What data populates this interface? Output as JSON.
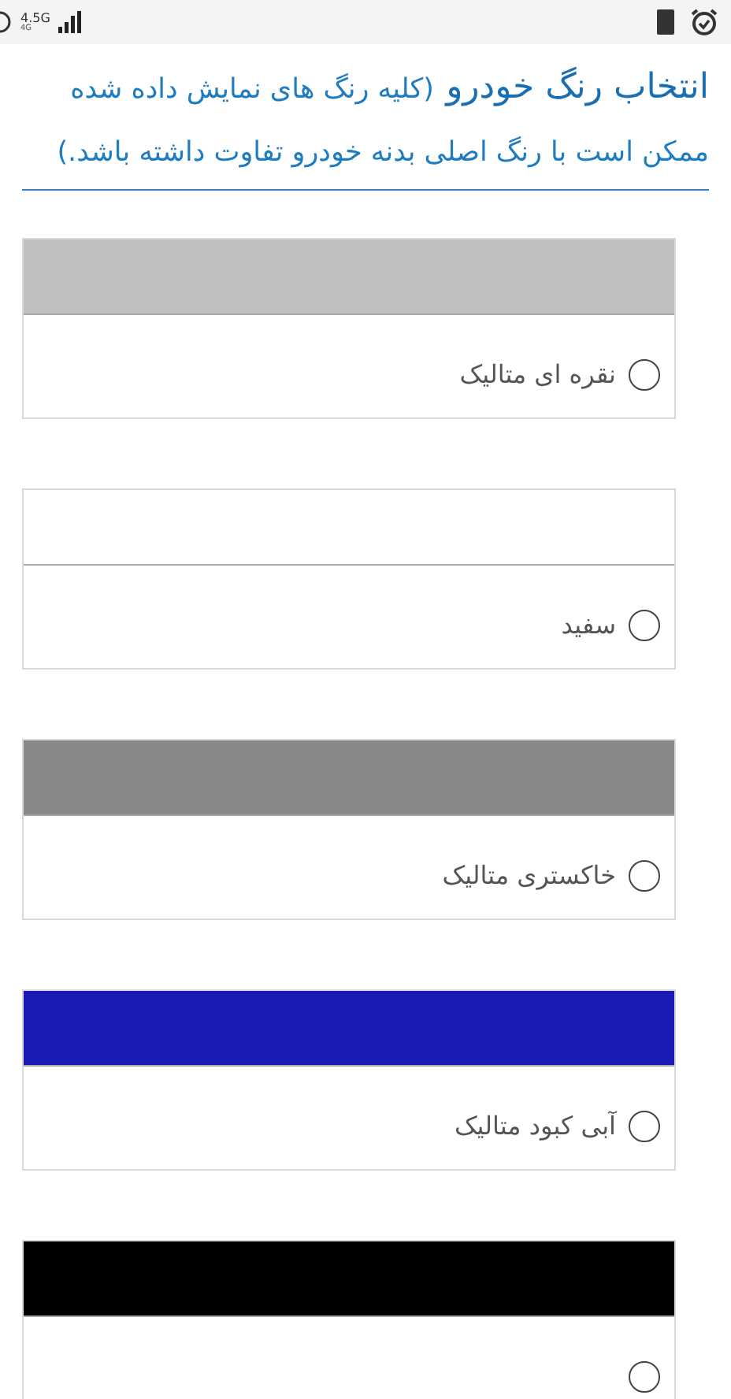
{
  "status_bar": {
    "network": "4.5G",
    "network_sub": "4G"
  },
  "section": {
    "title": "انتخاب رنگ خودرو",
    "note": "(کلیه رنگ های نمایش داده شده ممکن است با رنگ اصلی بدنه خودرو تفاوت داشته باشد.)"
  },
  "colors": [
    {
      "label": "نقره ای متالیک",
      "color": "#c0c0c0",
      "selected": false
    },
    {
      "label": "سفید",
      "color": "#ffffff",
      "selected": false
    },
    {
      "label": "خاکستری متالیک",
      "color": "#888888",
      "selected": false
    },
    {
      "label": "آبی کبود متالیک",
      "color": "#1a1ab4",
      "selected": false
    },
    {
      "color": "#000000",
      "selected": false
    }
  ]
}
